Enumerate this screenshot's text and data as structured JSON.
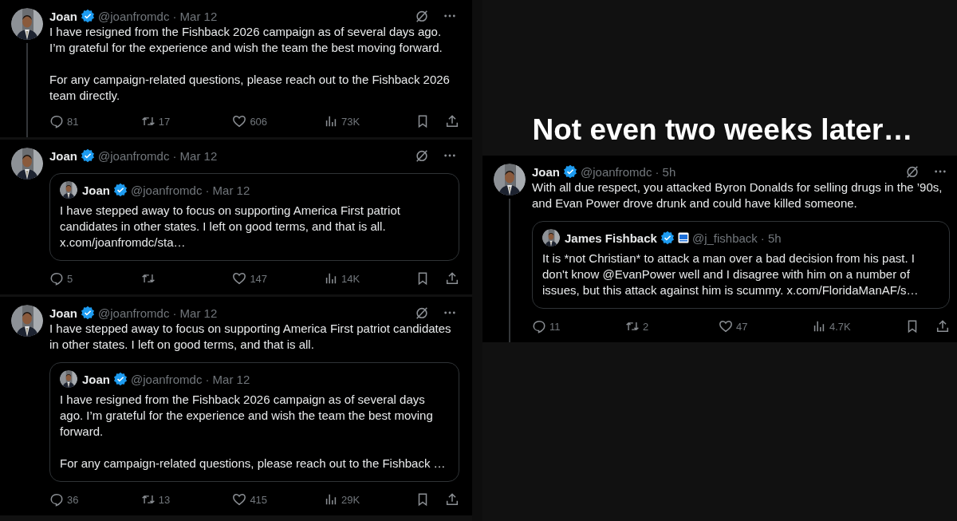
{
  "left_column": {
    "tweets": [
      {
        "author": "Joan",
        "verified": true,
        "handle": "@joanfromdc",
        "time": "· Mar 12",
        "thread_line": true,
        "paragraphs": [
          "I have resigned from the Fishback 2026 campaign as of several days ago. I’m grateful for the experience and wish the team the best moving forward.",
          "For any campaign-related questions, please reach out to the Fishback 2026 team directly."
        ],
        "stats": [
          {
            "kind": "reply",
            "count": "81"
          },
          {
            "kind": "repost",
            "count": "17"
          },
          {
            "kind": "like",
            "count": "606"
          },
          {
            "kind": "views",
            "count": "73K"
          },
          {
            "kind": "bookmark"
          },
          {
            "kind": "share"
          }
        ]
      },
      {
        "author": "Joan",
        "verified": true,
        "handle": "@joanfromdc",
        "time": "· Mar 12",
        "quote": {
          "author": "Joan",
          "verified": true,
          "handle": "@joanfromdc",
          "time": "· Mar 12",
          "paragraphs": [
            "I have stepped away to focus on supporting America First patriot candidates in other states. I left on good terms, and that is all."
          ],
          "link": "x.com/joanfromdc/sta…"
        },
        "stats": [
          {
            "kind": "reply",
            "count": "5"
          },
          {
            "kind": "repost"
          },
          {
            "kind": "like",
            "count": "147"
          },
          {
            "kind": "views",
            "count": "14K"
          },
          {
            "kind": "bookmark"
          },
          {
            "kind": "share"
          }
        ]
      },
      {
        "author": "Joan",
        "verified": true,
        "handle": "@joanfromdc",
        "time": "· Mar 12",
        "paragraphs": [
          "I have stepped away to focus on supporting America First patriot candidates in other states. I left on good terms, and that is all."
        ],
        "quote": {
          "author": "Joan",
          "verified": true,
          "handle": "@joanfromdc",
          "time": "· Mar 12",
          "paragraphs": [
            "I have resigned from the Fishback 2026 campaign as of several days ago. I’m grateful for the experience and wish the team the best moving forward.",
            "For any campaign-related questions, please reach out to the Fishback …"
          ]
        },
        "stats": [
          {
            "kind": "reply",
            "count": "36"
          },
          {
            "kind": "repost",
            "count": "13"
          },
          {
            "kind": "like",
            "count": "415"
          },
          {
            "kind": "views",
            "count": "29K"
          },
          {
            "kind": "bookmark"
          },
          {
            "kind": "share"
          }
        ]
      }
    ]
  },
  "right_panel": {
    "heading": "Not even two weeks later…",
    "tweet": {
      "author": "Joan",
      "verified": true,
      "handle": "@joanfromdc",
      "time": "· 5h",
      "thread_line": true,
      "paragraphs": [
        "With all due respect, you attacked Byron Donalds for selling drugs in the ’90s, and Evan Power drove drunk and could have killed someone."
      ],
      "quote": {
        "author": "James Fishback",
        "verified": true,
        "affiliate_badge": true,
        "handle": "@j_fishback",
        "time": "· 5h",
        "paragraphs": [
          "It is *not Christian* to attack a man over a bad decision from his past. I don't know @EvanPower well and I disagree with him on a number of issues, but this attack against him is scummy."
        ],
        "link": "x.com/FloridaManAF/s…"
      },
      "stats": [
        {
          "kind": "reply",
          "count": "11"
        },
        {
          "kind": "repost",
          "count": "2"
        },
        {
          "kind": "like",
          "count": "47"
        },
        {
          "kind": "views",
          "count": "4.7K"
        },
        {
          "kind": "bookmark"
        },
        {
          "kind": "share"
        }
      ]
    }
  }
}
